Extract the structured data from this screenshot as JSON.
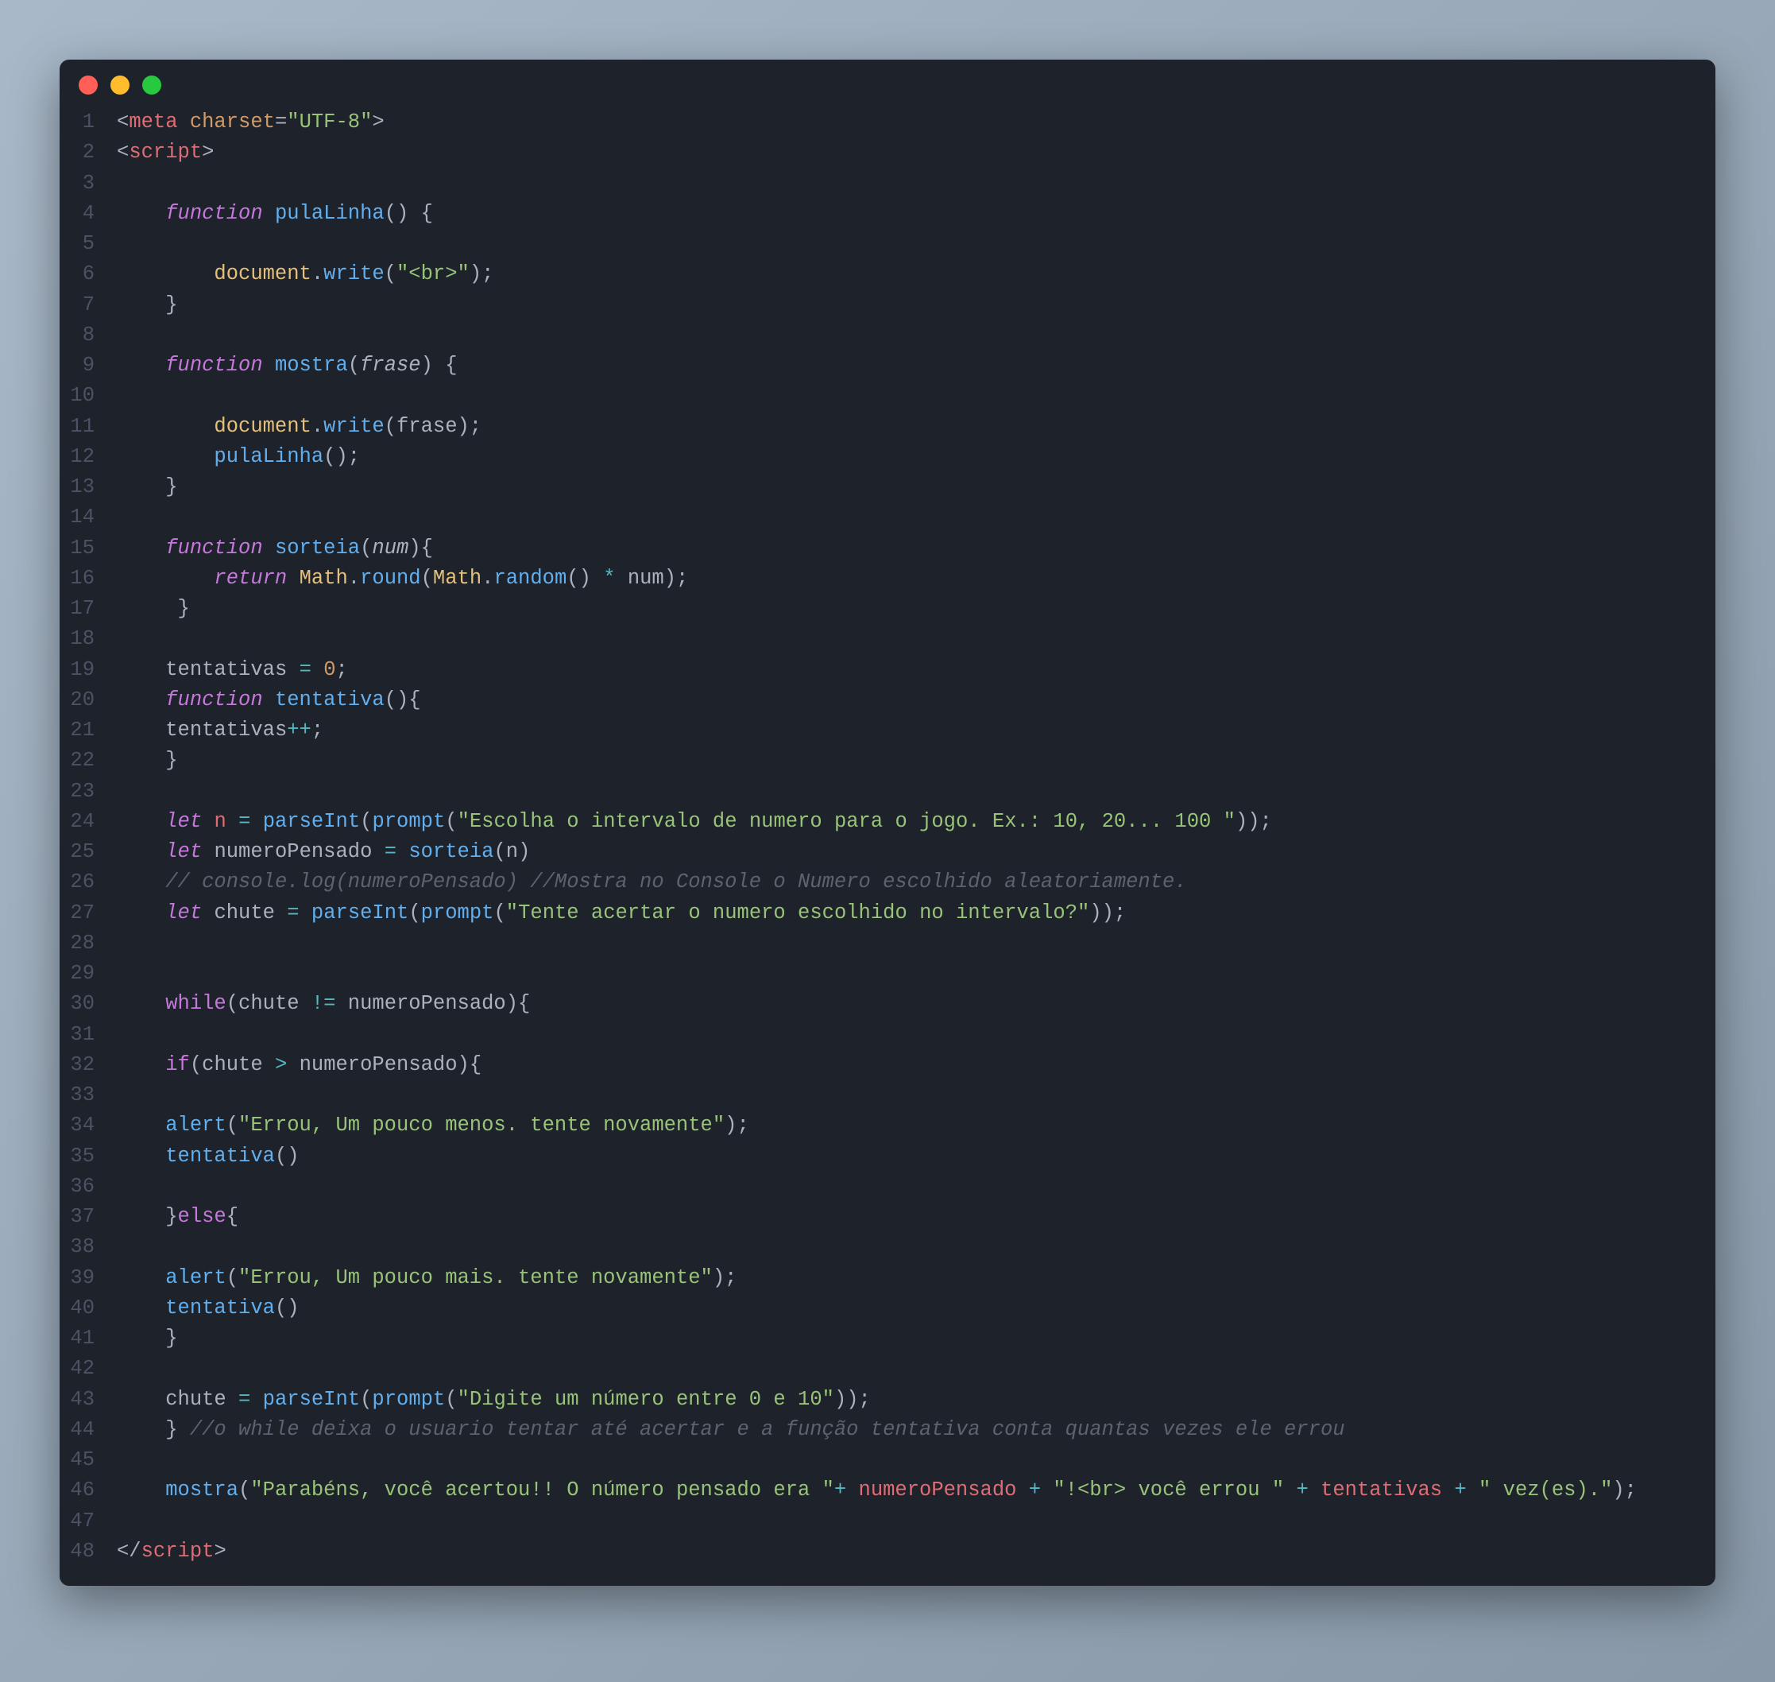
{
  "lines": [
    {
      "n": "1",
      "tokens": [
        {
          "t": "<",
          "c": "c-punct"
        },
        {
          "t": "meta ",
          "c": "c-tag"
        },
        {
          "t": "charset",
          "c": "c-attr"
        },
        {
          "t": "=",
          "c": "c-punct"
        },
        {
          "t": "\"UTF-8\"",
          "c": "c-string"
        },
        {
          "t": ">",
          "c": "c-punct"
        }
      ]
    },
    {
      "n": "2",
      "tokens": [
        {
          "t": "<",
          "c": "c-punct"
        },
        {
          "t": "script",
          "c": "c-tag"
        },
        {
          "t": ">",
          "c": "c-punct"
        }
      ]
    },
    {
      "n": "3",
      "tokens": []
    },
    {
      "n": "4",
      "tokens": [
        {
          "t": "    ",
          "c": ""
        },
        {
          "t": "function",
          "c": "c-keyword"
        },
        {
          "t": " ",
          "c": ""
        },
        {
          "t": "pulaLinha",
          "c": "c-func"
        },
        {
          "t": "() {",
          "c": "c-punct"
        }
      ]
    },
    {
      "n": "5",
      "tokens": []
    },
    {
      "n": "6",
      "tokens": [
        {
          "t": "        ",
          "c": ""
        },
        {
          "t": "document",
          "c": "c-obj"
        },
        {
          "t": ".",
          "c": "c-punct"
        },
        {
          "t": "write",
          "c": "c-func"
        },
        {
          "t": "(",
          "c": "c-punct"
        },
        {
          "t": "\"<br>\"",
          "c": "c-string"
        },
        {
          "t": ");",
          "c": "c-punct"
        }
      ]
    },
    {
      "n": "7",
      "tokens": [
        {
          "t": "    }",
          "c": "c-punct"
        }
      ]
    },
    {
      "n": "8",
      "tokens": []
    },
    {
      "n": "9",
      "tokens": [
        {
          "t": "    ",
          "c": ""
        },
        {
          "t": "function",
          "c": "c-keyword"
        },
        {
          "t": " ",
          "c": ""
        },
        {
          "t": "mostra",
          "c": "c-func"
        },
        {
          "t": "(",
          "c": "c-punct"
        },
        {
          "t": "frase",
          "c": "c-param"
        },
        {
          "t": ") {",
          "c": "c-punct"
        }
      ]
    },
    {
      "n": "10",
      "tokens": []
    },
    {
      "n": "11",
      "tokens": [
        {
          "t": "        ",
          "c": ""
        },
        {
          "t": "document",
          "c": "c-obj"
        },
        {
          "t": ".",
          "c": "c-punct"
        },
        {
          "t": "write",
          "c": "c-func"
        },
        {
          "t": "(",
          "c": "c-punct"
        },
        {
          "t": "frase",
          "c": ""
        },
        {
          "t": ");",
          "c": "c-punct"
        }
      ]
    },
    {
      "n": "12",
      "tokens": [
        {
          "t": "        ",
          "c": ""
        },
        {
          "t": "pulaLinha",
          "c": "c-func"
        },
        {
          "t": "();",
          "c": "c-punct"
        }
      ]
    },
    {
      "n": "13",
      "tokens": [
        {
          "t": "    }",
          "c": "c-punct"
        }
      ]
    },
    {
      "n": "14",
      "tokens": []
    },
    {
      "n": "15",
      "tokens": [
        {
          "t": "    ",
          "c": ""
        },
        {
          "t": "function",
          "c": "c-keyword"
        },
        {
          "t": " ",
          "c": ""
        },
        {
          "t": "sorteia",
          "c": "c-func"
        },
        {
          "t": "(",
          "c": "c-punct"
        },
        {
          "t": "num",
          "c": "c-param"
        },
        {
          "t": "){",
          "c": "c-punct"
        }
      ]
    },
    {
      "n": "16",
      "tokens": [
        {
          "t": "        ",
          "c": ""
        },
        {
          "t": "return",
          "c": "c-keyword"
        },
        {
          "t": " ",
          "c": ""
        },
        {
          "t": "Math",
          "c": "c-obj"
        },
        {
          "t": ".",
          "c": "c-punct"
        },
        {
          "t": "round",
          "c": "c-func"
        },
        {
          "t": "(",
          "c": "c-punct"
        },
        {
          "t": "Math",
          "c": "c-obj"
        },
        {
          "t": ".",
          "c": "c-punct"
        },
        {
          "t": "random",
          "c": "c-func"
        },
        {
          "t": "() ",
          "c": "c-punct"
        },
        {
          "t": "*",
          "c": "c-op"
        },
        {
          "t": " ",
          "c": ""
        },
        {
          "t": "num",
          "c": ""
        },
        {
          "t": ");",
          "c": "c-punct"
        }
      ]
    },
    {
      "n": "17",
      "tokens": [
        {
          "t": "     }",
          "c": "c-punct"
        }
      ]
    },
    {
      "n": "18",
      "tokens": []
    },
    {
      "n": "19",
      "tokens": [
        {
          "t": "    ",
          "c": ""
        },
        {
          "t": "tentativas",
          "c": ""
        },
        {
          "t": " ",
          "c": ""
        },
        {
          "t": "=",
          "c": "c-op"
        },
        {
          "t": " ",
          "c": ""
        },
        {
          "t": "0",
          "c": "c-num"
        },
        {
          "t": ";",
          "c": "c-punct"
        }
      ]
    },
    {
      "n": "20",
      "tokens": [
        {
          "t": "    ",
          "c": ""
        },
        {
          "t": "function",
          "c": "c-keyword"
        },
        {
          "t": " ",
          "c": ""
        },
        {
          "t": "tentativa",
          "c": "c-func"
        },
        {
          "t": "(){",
          "c": "c-punct"
        }
      ]
    },
    {
      "n": "21",
      "tokens": [
        {
          "t": "    ",
          "c": ""
        },
        {
          "t": "tentativas",
          "c": ""
        },
        {
          "t": "++",
          "c": "c-op"
        },
        {
          "t": ";",
          "c": "c-punct"
        }
      ]
    },
    {
      "n": "22",
      "tokens": [
        {
          "t": "    }",
          "c": "c-punct"
        }
      ]
    },
    {
      "n": "23",
      "tokens": []
    },
    {
      "n": "24",
      "tokens": [
        {
          "t": "    ",
          "c": ""
        },
        {
          "t": "let",
          "c": "c-keyword"
        },
        {
          "t": " ",
          "c": ""
        },
        {
          "t": "n",
          "c": "c-var"
        },
        {
          "t": " ",
          "c": ""
        },
        {
          "t": "=",
          "c": "c-op"
        },
        {
          "t": " ",
          "c": ""
        },
        {
          "t": "parseInt",
          "c": "c-func"
        },
        {
          "t": "(",
          "c": "c-punct"
        },
        {
          "t": "prompt",
          "c": "c-func"
        },
        {
          "t": "(",
          "c": "c-punct"
        },
        {
          "t": "\"Escolha o intervalo de numero para o jogo. Ex.: 10, 20... 100 \"",
          "c": "c-string"
        },
        {
          "t": "));",
          "c": "c-punct"
        }
      ]
    },
    {
      "n": "25",
      "tokens": [
        {
          "t": "    ",
          "c": ""
        },
        {
          "t": "let",
          "c": "c-keyword"
        },
        {
          "t": " ",
          "c": ""
        },
        {
          "t": "numeroPensado",
          "c": ""
        },
        {
          "t": " ",
          "c": ""
        },
        {
          "t": "=",
          "c": "c-op"
        },
        {
          "t": " ",
          "c": ""
        },
        {
          "t": "sorteia",
          "c": "c-func"
        },
        {
          "t": "(",
          "c": "c-punct"
        },
        {
          "t": "n",
          "c": ""
        },
        {
          "t": ")",
          "c": "c-punct"
        }
      ]
    },
    {
      "n": "26",
      "tokens": [
        {
          "t": "    ",
          "c": ""
        },
        {
          "t": "// console.log(numeroPensado) //Mostra no Console o Numero escolhido aleatoriamente.",
          "c": "c-comment"
        }
      ]
    },
    {
      "n": "27",
      "tokens": [
        {
          "t": "    ",
          "c": ""
        },
        {
          "t": "let",
          "c": "c-keyword"
        },
        {
          "t": " ",
          "c": ""
        },
        {
          "t": "chute",
          "c": ""
        },
        {
          "t": " ",
          "c": ""
        },
        {
          "t": "=",
          "c": "c-op"
        },
        {
          "t": " ",
          "c": ""
        },
        {
          "t": "parseInt",
          "c": "c-func"
        },
        {
          "t": "(",
          "c": "c-punct"
        },
        {
          "t": "prompt",
          "c": "c-func"
        },
        {
          "t": "(",
          "c": "c-punct"
        },
        {
          "t": "\"Tente acertar o numero escolhido no intervalo?\"",
          "c": "c-string"
        },
        {
          "t": "));",
          "c": "c-punct"
        }
      ]
    },
    {
      "n": "28",
      "tokens": []
    },
    {
      "n": "29",
      "tokens": []
    },
    {
      "n": "30",
      "tokens": [
        {
          "t": "    ",
          "c": ""
        },
        {
          "t": "while",
          "c": "c-keyword-n"
        },
        {
          "t": "(",
          "c": "c-punct"
        },
        {
          "t": "chute",
          "c": ""
        },
        {
          "t": " ",
          "c": ""
        },
        {
          "t": "!=",
          "c": "c-op"
        },
        {
          "t": " ",
          "c": ""
        },
        {
          "t": "numeroPensado",
          "c": ""
        },
        {
          "t": "){",
          "c": "c-punct"
        }
      ]
    },
    {
      "n": "31",
      "tokens": []
    },
    {
      "n": "32",
      "tokens": [
        {
          "t": "    ",
          "c": ""
        },
        {
          "t": "if",
          "c": "c-keyword-n"
        },
        {
          "t": "(",
          "c": "c-punct"
        },
        {
          "t": "chute",
          "c": ""
        },
        {
          "t": " ",
          "c": ""
        },
        {
          "t": ">",
          "c": "c-op"
        },
        {
          "t": " ",
          "c": ""
        },
        {
          "t": "numeroPensado",
          "c": ""
        },
        {
          "t": "){",
          "c": "c-punct"
        }
      ]
    },
    {
      "n": "33",
      "tokens": []
    },
    {
      "n": "34",
      "tokens": [
        {
          "t": "    ",
          "c": ""
        },
        {
          "t": "alert",
          "c": "c-func"
        },
        {
          "t": "(",
          "c": "c-punct"
        },
        {
          "t": "\"Errou, Um pouco menos. tente novamente\"",
          "c": "c-string"
        },
        {
          "t": ");",
          "c": "c-punct"
        }
      ]
    },
    {
      "n": "35",
      "tokens": [
        {
          "t": "    ",
          "c": ""
        },
        {
          "t": "tentativa",
          "c": "c-func"
        },
        {
          "t": "()",
          "c": "c-punct"
        }
      ]
    },
    {
      "n": "36",
      "tokens": []
    },
    {
      "n": "37",
      "tokens": [
        {
          "t": "    }",
          "c": "c-punct"
        },
        {
          "t": "else",
          "c": "c-keyword-n"
        },
        {
          "t": "{",
          "c": "c-punct"
        }
      ]
    },
    {
      "n": "38",
      "tokens": []
    },
    {
      "n": "39",
      "tokens": [
        {
          "t": "    ",
          "c": ""
        },
        {
          "t": "alert",
          "c": "c-func"
        },
        {
          "t": "(",
          "c": "c-punct"
        },
        {
          "t": "\"Errou, Um pouco mais. tente novamente\"",
          "c": "c-string"
        },
        {
          "t": ");",
          "c": "c-punct"
        }
      ]
    },
    {
      "n": "40",
      "tokens": [
        {
          "t": "    ",
          "c": ""
        },
        {
          "t": "tentativa",
          "c": "c-func"
        },
        {
          "t": "()",
          "c": "c-punct"
        }
      ]
    },
    {
      "n": "41",
      "tokens": [
        {
          "t": "    }",
          "c": "c-punct"
        }
      ]
    },
    {
      "n": "42",
      "tokens": []
    },
    {
      "n": "43",
      "tokens": [
        {
          "t": "    ",
          "c": ""
        },
        {
          "t": "chute",
          "c": ""
        },
        {
          "t": " ",
          "c": ""
        },
        {
          "t": "=",
          "c": "c-op"
        },
        {
          "t": " ",
          "c": ""
        },
        {
          "t": "parseInt",
          "c": "c-func"
        },
        {
          "t": "(",
          "c": "c-punct"
        },
        {
          "t": "prompt",
          "c": "c-func"
        },
        {
          "t": "(",
          "c": "c-punct"
        },
        {
          "t": "\"Digite um número entre 0 e 10\"",
          "c": "c-string"
        },
        {
          "t": "));",
          "c": "c-punct"
        }
      ]
    },
    {
      "n": "44",
      "tokens": [
        {
          "t": "    } ",
          "c": "c-punct"
        },
        {
          "t": "//o while deixa o usuario tentar até acertar e a função tentativa conta quantas vezes ele errou",
          "c": "c-comment"
        }
      ]
    },
    {
      "n": "45",
      "tokens": []
    },
    {
      "n": "46",
      "tokens": [
        {
          "t": "    ",
          "c": ""
        },
        {
          "t": "mostra",
          "c": "c-func"
        },
        {
          "t": "(",
          "c": "c-punct"
        },
        {
          "t": "\"Parabéns, você acertou!! O número pensado era \"",
          "c": "c-string"
        },
        {
          "t": "+",
          "c": "c-op"
        },
        {
          "t": " ",
          "c": ""
        },
        {
          "t": "numeroPensado",
          "c": "c-var"
        },
        {
          "t": " ",
          "c": ""
        },
        {
          "t": "+",
          "c": "c-op"
        },
        {
          "t": " ",
          "c": ""
        },
        {
          "t": "\"!<br> você errou \"",
          "c": "c-string"
        },
        {
          "t": " ",
          "c": ""
        },
        {
          "t": "+",
          "c": "c-op"
        },
        {
          "t": " ",
          "c": ""
        },
        {
          "t": "tentativas",
          "c": "c-var"
        },
        {
          "t": " ",
          "c": ""
        },
        {
          "t": "+",
          "c": "c-op"
        },
        {
          "t": " ",
          "c": ""
        },
        {
          "t": "\" vez(es).\"",
          "c": "c-string"
        },
        {
          "t": ");",
          "c": "c-punct"
        }
      ]
    },
    {
      "n": "47",
      "tokens": []
    },
    {
      "n": "48",
      "tokens": [
        {
          "t": "</",
          "c": "c-punct"
        },
        {
          "t": "script",
          "c": "c-tag"
        },
        {
          "t": ">",
          "c": "c-punct"
        }
      ]
    }
  ]
}
